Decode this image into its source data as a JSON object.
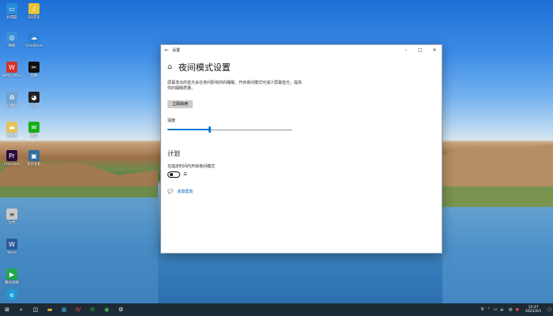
{
  "desktop": {
    "icons": [
      {
        "label": "此电脑",
        "icon": "computer-icon",
        "color": "#2a8bd8",
        "glyph": "▭"
      },
      {
        "label": "QQ音乐",
        "icon": "qq-music-icon",
        "color": "#e8c431",
        "glyph": "♪"
      },
      {
        "label": "网络",
        "icon": "network-icon",
        "color": "#3b8fd8",
        "glyph": "◎"
      },
      {
        "label": "OneDrive",
        "icon": "onedrive-icon",
        "color": "#2f7fd6",
        "glyph": "☁"
      },
      {
        "label": "WPS Office",
        "icon": "wps-icon",
        "color": "#d8312b",
        "glyph": "W"
      },
      {
        "label": "剪映",
        "icon": "capcut-icon",
        "color": "#111111",
        "glyph": "✂"
      },
      {
        "label": "回收站",
        "icon": "recycle-bin-icon",
        "color": "#6fa3d0",
        "glyph": "♻"
      },
      {
        "label": "QQ",
        "icon": "qq-icon",
        "color": "#222222",
        "glyph": "◕"
      },
      {
        "label": "文件夹",
        "icon": "folder-icon",
        "color": "#e6c25a",
        "glyph": "▬"
      },
      {
        "label": "微信",
        "icon": "wechat-icon",
        "color": "#1aad19",
        "glyph": "✉"
      },
      {
        "label": "Premiere",
        "icon": "premiere-icon",
        "color": "#2a0b3d",
        "glyph": "Pr"
      },
      {
        "label": "会声会影",
        "icon": "video-editor-icon",
        "color": "#2f6e9f",
        "glyph": "▣"
      },
      {
        "label": "文档",
        "icon": "doc-icon",
        "color": "#c9c9c9",
        "glyph": "≡"
      },
      {
        "label": "Word",
        "icon": "word-icon",
        "color": "#2b579a",
        "glyph": "W"
      },
      {
        "label": "腾讯视频",
        "icon": "tencent-video-icon",
        "color": "#20a84b",
        "glyph": "▶"
      },
      {
        "label": "Edge",
        "icon": "edge-icon",
        "color": "#1f9cd8",
        "glyph": "e"
      }
    ]
  },
  "window": {
    "title": "设置",
    "heading": "夜间模式设置",
    "description": "屏幕发出的蓝光会在夜间影响你的睡眠。开启夜间模式可减少屏幕蓝光，提高你的睡眠质量。",
    "enable_now_button": "立即启用",
    "strength_label": "强度",
    "strength_value": 0.34,
    "schedule_heading": "计划",
    "schedule_label": "在指定时间内开启夜间模式",
    "toggle_state": "关",
    "help_link": "获取帮助"
  },
  "taskbar": {
    "items": [
      {
        "icon": "windows-start-icon",
        "glyph": "⊞"
      },
      {
        "icon": "search-icon",
        "glyph": "⌕"
      },
      {
        "icon": "task-view-icon",
        "glyph": "◫"
      },
      {
        "icon": "file-explorer-icon",
        "glyph": "▬"
      },
      {
        "icon": "store-icon",
        "glyph": "▦"
      },
      {
        "icon": "wps-taskbar-icon",
        "glyph": "W"
      },
      {
        "icon": "wechat-taskbar-icon",
        "glyph": "✉"
      },
      {
        "icon": "green-app-icon",
        "glyph": "◉"
      },
      {
        "icon": "settings-icon",
        "glyph": "⚙"
      }
    ],
    "time": "15:27",
    "date": "2021/4/1"
  }
}
